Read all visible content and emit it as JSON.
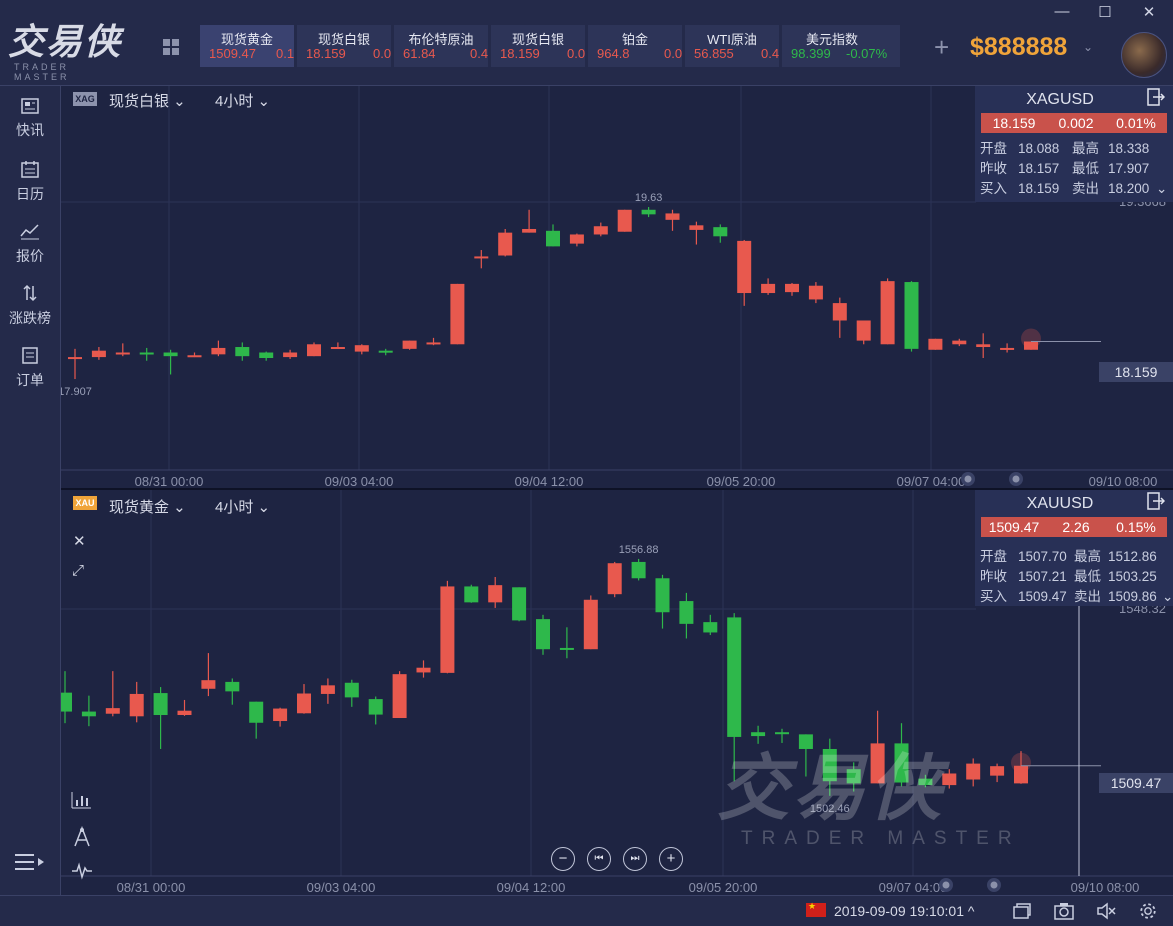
{
  "window": {
    "minimize": "—",
    "maximize": "☐",
    "close": "✕"
  },
  "logo": {
    "cn": "交易侠",
    "en": "TRADER MASTER"
  },
  "tickers": [
    {
      "name": "现货黄金",
      "price": "1509.47",
      "change": "0.1",
      "dir": "up",
      "active": true
    },
    {
      "name": "现货白银",
      "price": "18.159",
      "change": "0.0",
      "dir": "up",
      "active": false
    },
    {
      "name": "布伦特原油",
      "price": "61.84",
      "change": "0.4",
      "dir": "up",
      "active": false
    },
    {
      "name": "现货白银",
      "price": "18.159",
      "change": "0.0",
      "dir": "up",
      "active": false
    },
    {
      "name": "铂金",
      "price": "964.8",
      "change": "0.0",
      "dir": "up",
      "active": false
    },
    {
      "name": "WTI原油",
      "price": "56.855",
      "change": "0.4",
      "dir": "up",
      "active": false
    },
    {
      "name": "美元指数",
      "price": "98.399",
      "change": "-0.07%",
      "dir": "down",
      "active": false
    }
  ],
  "balance": {
    "plus": "+",
    "amount": "$888888",
    "caret": "⌄"
  },
  "sidebar": [
    {
      "label": "快讯",
      "icon": "news-icon"
    },
    {
      "label": "日历",
      "icon": "calendar-icon"
    },
    {
      "label": "报价",
      "icon": "quote-icon"
    },
    {
      "label": "涨跌榜",
      "icon": "ranking-icon"
    },
    {
      "label": "订单",
      "icon": "order-icon"
    }
  ],
  "panel_top": {
    "tag": "XAG",
    "symbol_name": "现货白银 ⌄",
    "interval": "4小时 ⌄",
    "quote": {
      "symbol": "XAGUSD",
      "last": "18.159",
      "change": "0.002",
      "percent": "0.01%",
      "open_label": "开盘",
      "open": "18.088",
      "high_label": "最高",
      "high": "18.338",
      "prev_label": "昨收",
      "prev": "18.157",
      "low_label": "最低",
      "low": "17.907",
      "buy_label": "买入",
      "buy": "18.159",
      "sell_label": "卖出",
      "sell": "18.200",
      "expand": "⌄"
    },
    "axis_top_value": "19.3668",
    "price_tag": "18.159",
    "x_labels": [
      "08/31 00:00",
      "09/03 04:00",
      "09/04 12:00",
      "09/05 20:00",
      "09/07 04:00",
      "09/10 08:00"
    ],
    "high_label": "19.63",
    "low_label": "17.907"
  },
  "panel_bottom": {
    "tag": "XAU",
    "symbol_name": "现货黄金 ⌄",
    "interval": "4小时 ⌄",
    "quote": {
      "symbol": "XAUUSD",
      "last": "1509.47",
      "change": "2.26",
      "percent": "0.15%",
      "open_label": "开盘",
      "open": "1507.70",
      "high_label": "最高",
      "high": "1512.86",
      "prev_label": "昨收",
      "prev": "1507.21",
      "low_label": "最低",
      "low": "1503.25",
      "buy_label": "买入",
      "buy": "1509.47",
      "sell_label": "卖出",
      "sell": "1509.86",
      "expand": "⌄"
    },
    "axis_top_value": "1548.32",
    "price_tag": "1509.47",
    "x_labels": [
      "08/31 00:00",
      "09/03 04:00",
      "09/04 12:00",
      "09/05 20:00",
      "09/07 04:00",
      "09/10 08:00"
    ],
    "high_label": "1556.88",
    "low_label": "1502.46",
    "close_btn": "✕",
    "expand_btn": "⤢",
    "zoom": {
      "out": "−",
      "first": "⏮",
      "last": "⏭",
      "in": "+"
    }
  },
  "watermark": {
    "cn": "交易侠",
    "en": "TRADER MASTER"
  },
  "status": {
    "datetime": "2019-09-09 19:10:01 ^"
  },
  "colors": {
    "up": "#e8594e",
    "down": "#2eb84b",
    "bg": "#1e2442"
  },
  "chart_data": [
    {
      "type": "candlestick",
      "title": "XAGUSD 4小时",
      "categories": [
        "08/31 00:00",
        "09/03 04:00",
        "09/04 12:00",
        "09/05 20:00",
        "09/07 04:00",
        "09/10 08:00"
      ],
      "candles": [
        [
          17.98,
          17.99,
          18.08,
          17.75
        ],
        [
          17.99,
          18.06,
          18.1,
          17.96
        ],
        [
          18.02,
          18.04,
          18.14,
          18.0
        ],
        [
          18.04,
          18.02,
          18.09,
          17.95
        ],
        [
          18.04,
          18.0,
          18.07,
          17.8
        ],
        [
          18.0,
          18.01,
          18.04,
          17.99
        ],
        [
          18.02,
          18.09,
          18.17,
          18.0
        ],
        [
          18.1,
          18.0,
          18.15,
          17.95
        ],
        [
          18.04,
          17.98,
          18.05,
          17.95
        ],
        [
          17.99,
          18.04,
          18.07,
          17.97
        ],
        [
          18.0,
          18.13,
          18.15,
          18.0
        ],
        [
          18.1,
          18.1,
          18.15,
          18.08
        ],
        [
          18.05,
          18.12,
          18.13,
          18.02
        ],
        [
          18.06,
          18.04,
          18.08,
          18.01
        ],
        [
          18.08,
          18.17,
          18.17,
          18.07
        ],
        [
          18.14,
          18.15,
          18.2,
          18.12
        ],
        [
          18.13,
          18.79,
          18.79,
          18.13
        ],
        [
          19.09,
          19.09,
          19.16,
          18.96
        ],
        [
          19.1,
          19.35,
          19.39,
          19.09
        ],
        [
          19.35,
          19.39,
          19.6,
          19.35
        ],
        [
          19.37,
          19.2,
          19.44,
          19.2
        ],
        [
          19.23,
          19.33,
          19.34,
          19.2
        ],
        [
          19.33,
          19.42,
          19.46,
          19.31
        ],
        [
          19.36,
          19.6,
          19.6,
          19.36
        ],
        [
          19.6,
          19.55,
          19.63,
          19.52
        ],
        [
          19.49,
          19.56,
          19.6,
          19.37
        ],
        [
          19.38,
          19.43,
          19.47,
          19.22
        ],
        [
          19.41,
          19.31,
          19.44,
          19.24
        ],
        [
          18.69,
          19.26,
          19.27,
          18.55
        ],
        [
          18.69,
          18.79,
          18.85,
          18.67
        ],
        [
          18.7,
          18.79,
          18.8,
          18.66
        ],
        [
          18.62,
          18.77,
          18.81,
          18.58
        ],
        [
          18.39,
          18.58,
          18.64,
          18.2
        ],
        [
          18.17,
          18.39,
          18.39,
          18.13
        ],
        [
          18.13,
          18.82,
          18.85,
          18.13
        ],
        [
          18.81,
          18.08,
          18.82,
          18.05
        ],
        [
          18.07,
          18.19,
          18.19,
          18.07
        ],
        [
          18.13,
          18.17,
          18.19,
          18.11
        ],
        [
          18.1,
          18.13,
          18.25,
          17.98
        ],
        [
          18.07,
          18.09,
          18.14,
          18.04
        ],
        [
          18.07,
          18.16,
          18.16,
          18.07
        ]
      ]
    },
    {
      "type": "candlestick",
      "title": "XAUUSD 4小时",
      "categories": [
        "08/31 00:00",
        "09/03 04:00",
        "09/04 12:00",
        "09/05 20:00",
        "09/07 04:00",
        "09/10 08:00"
      ],
      "candles": [
        [
          1526.5,
          1522.1,
          1531.5,
          1519.4
        ],
        [
          1522.1,
          1521.0,
          1525.8,
          1518.7
        ],
        [
          1521.6,
          1522.9,
          1531.5,
          1521.0
        ],
        [
          1521.0,
          1526.2,
          1529.0,
          1519.6
        ],
        [
          1526.4,
          1521.3,
          1527.8,
          1513.4
        ],
        [
          1521.3,
          1522.3,
          1524.8,
          1521.1
        ],
        [
          1527.4,
          1529.4,
          1535.7,
          1525.7
        ],
        [
          1529.0,
          1526.8,
          1529.8,
          1523.7
        ],
        [
          1524.4,
          1519.5,
          1524.4,
          1515.8
        ],
        [
          1519.9,
          1522.8,
          1523.0,
          1518.6
        ],
        [
          1521.7,
          1526.3,
          1528.5,
          1521.6
        ],
        [
          1526.2,
          1528.2,
          1529.8,
          1523.9
        ],
        [
          1528.8,
          1525.4,
          1529.5,
          1523.2
        ],
        [
          1525.0,
          1521.4,
          1525.6,
          1519.1
        ],
        [
          1520.6,
          1530.8,
          1531.5,
          1520.6
        ],
        [
          1531.2,
          1532.3,
          1534.0,
          1530.0
        ],
        [
          1531.1,
          1551.2,
          1552.5,
          1531.0
        ],
        [
          1551.2,
          1547.5,
          1551.6,
          1547.4
        ],
        [
          1547.5,
          1551.5,
          1553.4,
          1546.2
        ],
        [
          1551.0,
          1543.3,
          1551.0,
          1543.1
        ],
        [
          1543.6,
          1536.6,
          1544.6,
          1535.3
        ],
        [
          1536.9,
          1536.6,
          1541.7,
          1534.5
        ],
        [
          1536.6,
          1548.1,
          1549.1,
          1536.6
        ],
        [
          1549.4,
          1556.6,
          1556.9,
          1548.7
        ],
        [
          1556.9,
          1553.1,
          1557.6,
          1552.6
        ],
        [
          1553.1,
          1545.2,
          1553.9,
          1541.4
        ],
        [
          1547.8,
          1542.5,
          1549.7,
          1539.1
        ],
        [
          1542.9,
          1540.5,
          1544.6,
          1539.9
        ],
        [
          1544.0,
          1516.2,
          1545.0,
          1505.9
        ],
        [
          1517.3,
          1516.4,
          1518.8,
          1514.6
        ],
        [
          1517.3,
          1517.0,
          1518.1,
          1514.8
        ],
        [
          1516.8,
          1513.4,
          1516.8,
          1507.0
        ],
        [
          1513.4,
          1505.9,
          1515.8,
          1502.5
        ],
        [
          1508.7,
          1505.4,
          1510.3,
          1503.5
        ],
        [
          1505.4,
          1514.7,
          1522.3,
          1505.4
        ],
        [
          1514.7,
          1505.6,
          1519.4,
          1504.7
        ],
        [
          1506.5,
          1505.0,
          1507.4,
          1504.5
        ],
        [
          1505.0,
          1507.7,
          1508.7,
          1504.2
        ],
        [
          1506.3,
          1510.0,
          1511.2,
          1504.7
        ],
        [
          1507.2,
          1509.4,
          1510.0,
          1505.7
        ],
        [
          1505.4,
          1509.5,
          1512.9,
          1505.3
        ]
      ]
    }
  ]
}
